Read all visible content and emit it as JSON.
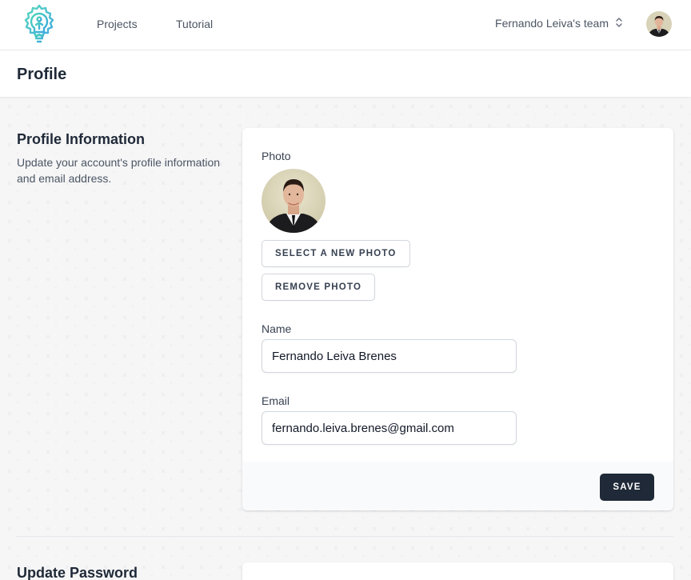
{
  "nav": {
    "logo_icon": "lightbulb-gear-logo",
    "links": [
      {
        "label": "Projects"
      },
      {
        "label": "Tutorial"
      }
    ],
    "team_switcher": {
      "label": "Fernando Leiva's team",
      "icon": "chevron-up-down-icon"
    },
    "avatar_icon": "user-avatar"
  },
  "page": {
    "title": "Profile"
  },
  "profile_section": {
    "title": "Profile Information",
    "description": "Update your account's profile information and email address.",
    "photo_label": "Photo",
    "select_photo_label": "SELECT A NEW PHOTO",
    "remove_photo_label": "REMOVE PHOTO",
    "name_label": "Name",
    "name_value": "Fernando Leiva Brenes",
    "email_label": "Email",
    "email_value": "fernando.leiva.brenes@gmail.com",
    "save_label": "SAVE"
  },
  "password_section": {
    "title": "Update Password"
  },
  "colors": {
    "accent_teal": "#3cc9c9",
    "dark_button": "#1f2937",
    "background": "#f6f6f7"
  }
}
